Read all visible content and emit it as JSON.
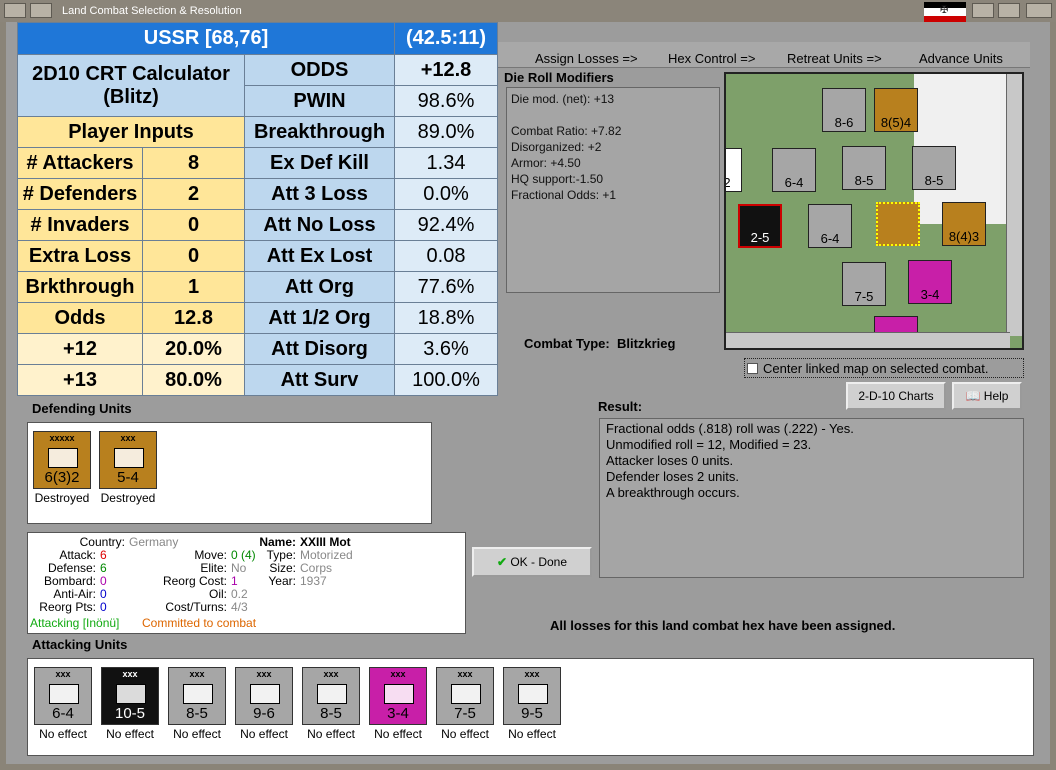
{
  "window": {
    "title": "Land Combat Selection & Resolution"
  },
  "calc": {
    "header": {
      "left": "USSR [68,76]",
      "right": "(42.5:11)"
    },
    "title1": "2D10 CRT Calculator",
    "title2": "(Blitz)",
    "player_inputs": "Player Inputs",
    "inputs": [
      {
        "label": "# Attackers",
        "value": "8"
      },
      {
        "label": "# Defenders",
        "value": "2"
      },
      {
        "label": "# Invaders",
        "value": "0"
      },
      {
        "label": "Extra Loss",
        "value": "0"
      },
      {
        "label": "Brkthrough",
        "value": "1"
      },
      {
        "label": "Odds",
        "value": "12.8"
      },
      {
        "label": "+12",
        "value": "20.0%"
      },
      {
        "label": "+13",
        "value": "80.0%"
      }
    ],
    "results": [
      {
        "label": "ODDS",
        "value": "+12.8"
      },
      {
        "label": "PWIN",
        "value": "98.6%"
      },
      {
        "label": "Breakthrough",
        "value": "89.0%"
      },
      {
        "label": "Ex Def Kill",
        "value": "1.34"
      },
      {
        "label": "Att 3 Loss",
        "value": "0.0%"
      },
      {
        "label": "Att No Loss",
        "value": "92.4%"
      },
      {
        "label": "Att Ex Lost",
        "value": "0.08"
      },
      {
        "label": "Att Org",
        "value": "77.6%"
      },
      {
        "label": "Att 1/2 Org",
        "value": "18.8%"
      },
      {
        "label": "Att Disorg",
        "value": "3.6%"
      },
      {
        "label": "Att Surv",
        "value": "100.0%"
      }
    ]
  },
  "steps": [
    "Assign Losses =>",
    "Hex Control =>",
    "Retreat Units =>",
    "Advance Units"
  ],
  "die_roll": {
    "header": "Die Roll Modifiers",
    "lines": [
      "Die mod. (net): +13",
      "",
      "Combat Ratio: +7.82",
      "Disorganized: +2",
      "Armor: +4.50",
      "HQ support:-1.50",
      "Fractional Odds: +1"
    ]
  },
  "map_units": [
    "8-6",
    "8(5)4",
    "2",
    "6-4",
    "8-5",
    "8-5",
    "2-5",
    "6-4",
    "8(4)3",
    "7-5",
    "3-4"
  ],
  "combat_type": {
    "label": "Combat Type:",
    "value": "Blitzkrieg"
  },
  "center_label": "Center linked map on selected combat.",
  "buttons": {
    "charts": "2-D-10 Charts",
    "help": "Help",
    "ok": "OK - Done"
  },
  "defending": {
    "header": "Defending Units",
    "units": [
      {
        "strength": "6(3)2",
        "size": "xxxxx",
        "status": "Destroyed",
        "color": "#b8801e"
      },
      {
        "strength": "5-4",
        "size": "xxx",
        "status": "Destroyed",
        "color": "#b8801e"
      }
    ]
  },
  "info": {
    "country_label": "Country:",
    "country": "Germany",
    "attack_label": "Attack:",
    "attack": "6",
    "defense_label": "Defense:",
    "defense": "6",
    "bombard_label": "Bombard:",
    "bombard": "0",
    "antiair_label": "Anti-Air:",
    "antiair": "0",
    "reorg_label": "Reorg Pts:",
    "reorg": "0",
    "move_label": "Move:",
    "move": "0 (4)",
    "elite_label": "Elite:",
    "elite": "No",
    "reorgcost_label": "Reorg Cost:",
    "reorgcost": "1",
    "oil_label": "Oil:",
    "oil": "0.2",
    "cost_label": "Cost/Turns:",
    "cost": "4/3",
    "name_label": "Name:",
    "name": "XXIII Mot",
    "type_label": "Type:",
    "type": "Motorized",
    "size_label": "Size:",
    "size": "Corps",
    "year_label": "Year:",
    "year": "1937",
    "attacking": "Attacking [Inönü]",
    "committed": "Committed to combat"
  },
  "result": {
    "header": "Result:",
    "lines": [
      "Fractional odds (.818) roll was (.222)  - Yes.",
      "Unmodified roll = 12, Modified = 23.",
      "Attacker loses 0 units.",
      "Defender loses 2 units.",
      "A breakthrough occurs."
    ]
  },
  "all_losses": "All losses for this land combat hex have been assigned.",
  "attacking": {
    "header": "Attacking Units",
    "units": [
      {
        "strength": "6-4",
        "size": "xxx",
        "status": "No effect",
        "color": "#a6a6a6"
      },
      {
        "strength": "10-5",
        "size": "xxx",
        "status": "No effect",
        "color": "#111111"
      },
      {
        "strength": "8-5",
        "size": "xxx",
        "status": "No effect",
        "color": "#a6a6a6"
      },
      {
        "strength": "9-6",
        "size": "xxx",
        "status": "No effect",
        "color": "#a6a6a6"
      },
      {
        "strength": "8-5",
        "size": "xxx",
        "status": "No effect",
        "color": "#a6a6a6"
      },
      {
        "strength": "3-4",
        "size": "xxx",
        "status": "No effect",
        "color": "#c81fa8"
      },
      {
        "strength": "7-5",
        "size": "xxx",
        "status": "No effect",
        "color": "#a6a6a6"
      },
      {
        "strength": "9-5",
        "size": "xxx",
        "status": "No effect",
        "color": "#a6a6a6"
      }
    ]
  }
}
